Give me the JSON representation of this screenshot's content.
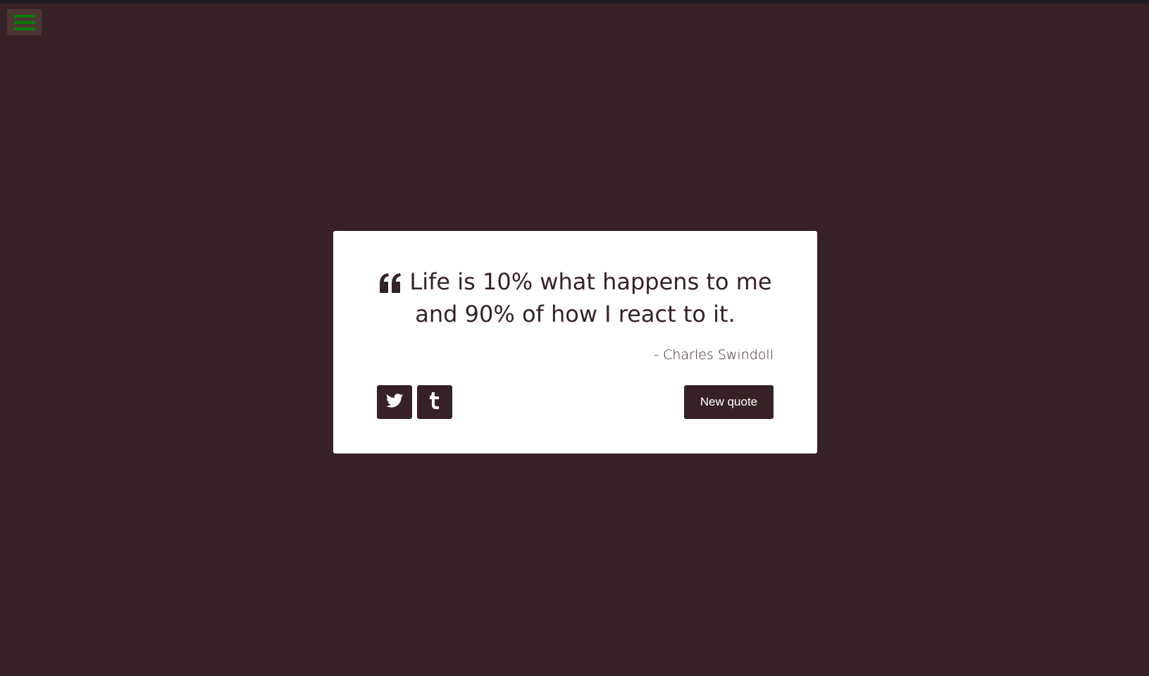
{
  "colors": {
    "background": "#362226",
    "card": "#ffffff",
    "accent": "#362226",
    "menu_bar": "#0a7a0a"
  },
  "menu": {
    "icon": "hamburger-menu-icon"
  },
  "quote": {
    "icon": "quote-left-icon",
    "text": "Life is 10% what happens to me and 90% of how I react to it.",
    "author": "- Charles Swindoll"
  },
  "actions": {
    "twitter_icon": "twitter-icon",
    "tumblr_icon": "tumblr-icon",
    "new_quote_label": "New quote"
  }
}
